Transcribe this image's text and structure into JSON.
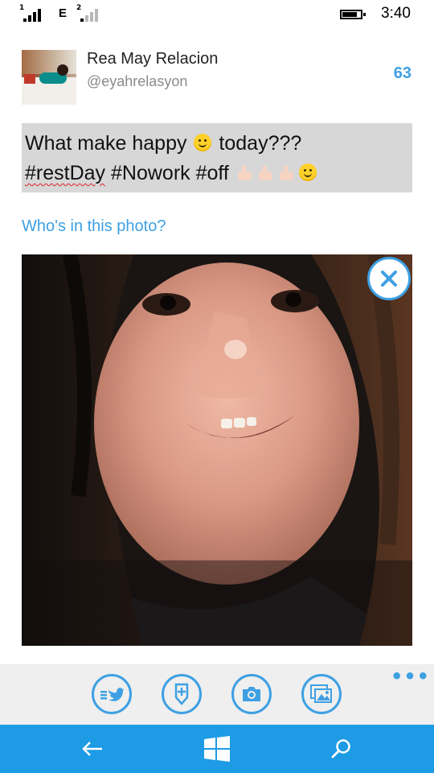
{
  "status_bar": {
    "sim1_label": "1",
    "sim2_label": "2",
    "network_type": "E",
    "time": "3:40",
    "battery_icon": "battery-icon"
  },
  "profile": {
    "name": "Rea May Relacion",
    "handle": "@eyahrelasyon",
    "remaining_chars": "63"
  },
  "tweet": {
    "line1_prefix": "What make happy",
    "line1_suffix": "today???",
    "hashtag_misspelled": "#restDay",
    "hashtags_rest": "#Nowork #off"
  },
  "photo": {
    "tag_prompt": "Who's in this photo?",
    "remove_icon": "close-icon"
  },
  "app_bar": {
    "buttons": [
      {
        "icon": "tweet-send-icon"
      },
      {
        "icon": "location-pin-icon"
      },
      {
        "icon": "camera-icon"
      },
      {
        "icon": "gallery-icon"
      }
    ],
    "more_label": "•••"
  },
  "nav_bar": {
    "buttons": [
      {
        "icon": "back-arrow-icon"
      },
      {
        "icon": "windows-start-icon"
      },
      {
        "icon": "search-icon"
      }
    ]
  },
  "colors": {
    "accent": "#3ea0e3",
    "nav_background": "#1d9be5",
    "tweet_box_background": "#d7d7d7",
    "app_bar_background": "#efefef"
  }
}
